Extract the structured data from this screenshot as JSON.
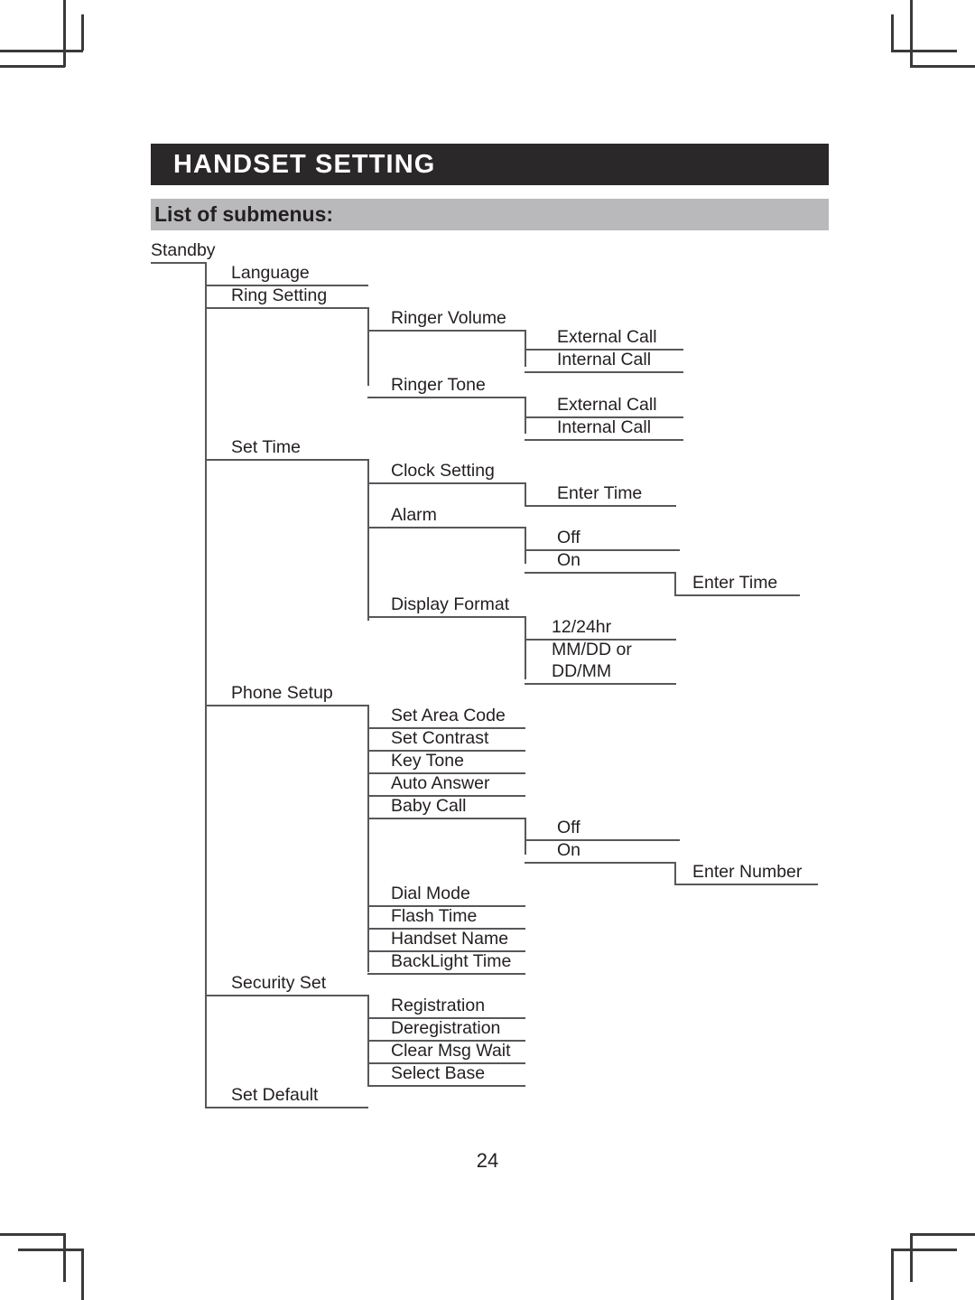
{
  "page": {
    "title": "HANDSET SETTING",
    "subtitle": "List of submenus:",
    "number": "24",
    "colors": {
      "title_bar_bg": "#2b2829",
      "title_bar_text": "#ffffff",
      "subtitle_bar_bg": "#b9b9bb",
      "text": "#231f20",
      "line": "#58585b",
      "crop_mark": "#3a3a3a"
    }
  },
  "tree": {
    "root": "Standby",
    "nodes": [
      {
        "id": "language",
        "label": "Language",
        "level": 1
      },
      {
        "id": "ring-setting",
        "label": "Ring Setting",
        "level": 1
      },
      {
        "id": "ringer-volume",
        "label": "Ringer Volume",
        "level": 2
      },
      {
        "id": "rv-external",
        "label": "External Call",
        "level": 3
      },
      {
        "id": "rv-internal",
        "label": "Internal Call",
        "level": 3
      },
      {
        "id": "ringer-tone",
        "label": "Ringer Tone",
        "level": 2
      },
      {
        "id": "rt-external",
        "label": "External Call",
        "level": 3
      },
      {
        "id": "rt-internal",
        "label": "Internal Call",
        "level": 3
      },
      {
        "id": "set-time",
        "label": "Set Time",
        "level": 1
      },
      {
        "id": "clock-setting",
        "label": "Clock Setting",
        "level": 2
      },
      {
        "id": "cs-enter-time",
        "label": "Enter Time",
        "level": 3
      },
      {
        "id": "alarm",
        "label": "Alarm",
        "level": 2
      },
      {
        "id": "alarm-off",
        "label": "Off",
        "level": 3
      },
      {
        "id": "alarm-on",
        "label": "On",
        "level": 3
      },
      {
        "id": "alarm-enter-time",
        "label": "Enter Time",
        "level": 4
      },
      {
        "id": "display-format",
        "label": "Display Format",
        "level": 2
      },
      {
        "id": "df-1224hr",
        "label": "12/24hr",
        "level": 3
      },
      {
        "id": "df-mmdd",
        "label": "MM/DD or",
        "level": 3
      },
      {
        "id": "df-mmdd-2",
        "label": "DD/MM",
        "level": 3
      },
      {
        "id": "phone-setup",
        "label": "Phone Setup",
        "level": 1
      },
      {
        "id": "set-area-code",
        "label": "Set Area Code",
        "level": 2
      },
      {
        "id": "set-contrast",
        "label": "Set Contrast",
        "level": 2
      },
      {
        "id": "key-tone",
        "label": "Key Tone",
        "level": 2
      },
      {
        "id": "auto-answer",
        "label": "Auto Answer",
        "level": 2
      },
      {
        "id": "baby-call",
        "label": "Baby Call",
        "level": 2
      },
      {
        "id": "bc-off",
        "label": "Off",
        "level": 3
      },
      {
        "id": "bc-on",
        "label": "On",
        "level": 3
      },
      {
        "id": "bc-enter-number",
        "label": "Enter Number",
        "level": 4
      },
      {
        "id": "dial-mode",
        "label": "Dial Mode",
        "level": 2
      },
      {
        "id": "flash-time",
        "label": "Flash Time",
        "level": 2
      },
      {
        "id": "handset-name",
        "label": "Handset Name",
        "level": 2
      },
      {
        "id": "backlight-time",
        "label": "BackLight Time",
        "level": 2
      },
      {
        "id": "security-set",
        "label": "Security Set",
        "level": 1
      },
      {
        "id": "registration",
        "label": "Registration",
        "level": 2
      },
      {
        "id": "deregistration",
        "label": "Deregistration",
        "level": 2
      },
      {
        "id": "clear-msg-wait",
        "label": "Clear Msg Wait",
        "level": 2
      },
      {
        "id": "select-base",
        "label": "Select Base",
        "level": 2
      },
      {
        "id": "set-default",
        "label": "Set Default",
        "level": 1
      }
    ]
  }
}
